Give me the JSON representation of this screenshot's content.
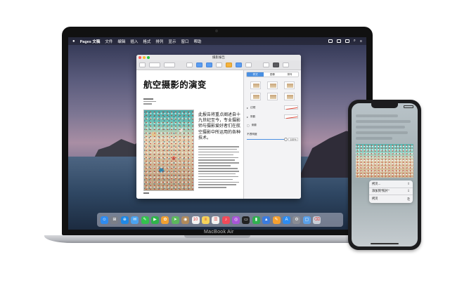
{
  "menubar": {
    "app_name": "Pages 文稿",
    "items": [
      "文件",
      "编辑",
      "插入",
      "格式",
      "排列",
      "显示",
      "窗口",
      "帮助"
    ]
  },
  "window": {
    "title": "摄影报告",
    "lights": [
      "#ff5f57",
      "#febc2e",
      "#28c840"
    ]
  },
  "document": {
    "title": "航空摄影的演变",
    "lead": "此报告将重点阐述自十九世纪至今，专业摄影师与摄影爱好者们在航空摄影中所运用的各种技术。"
  },
  "sidebar": {
    "tabs": [
      "样式",
      "图像",
      "排列"
    ],
    "active_tab": 0,
    "rows": [
      "边框",
      "阴影",
      "倒影"
    ],
    "opacity_label": "不透明度",
    "opacity_value": "100%",
    "opacity_level": 1.0
  },
  "dock": {
    "icons": [
      {
        "name": "finder-icon",
        "color": "#2f8cf0",
        "glyph": "☺"
      },
      {
        "name": "launchpad-icon",
        "color": "#7b7f88",
        "glyph": "⊞"
      },
      {
        "name": "safari-icon",
        "color": "#1e88e5",
        "glyph": "⊕"
      },
      {
        "name": "mail-icon",
        "color": "#4aa3f0",
        "glyph": "✉"
      },
      {
        "name": "messages-icon",
        "color": "#33c24d",
        "glyph": "✎"
      },
      {
        "name": "facetime-icon",
        "color": "#2fb34a",
        "glyph": "▶"
      },
      {
        "name": "photos-icon",
        "color": "#f0a030",
        "glyph": "✿"
      },
      {
        "name": "maps-icon",
        "color": "#5cb85c",
        "glyph": "➤"
      },
      {
        "name": "contacts-icon",
        "color": "#b08a5a",
        "glyph": "◉"
      },
      {
        "name": "calendar-icon",
        "color": "#f2f2f2",
        "glyph": "10"
      },
      {
        "name": "notes-icon",
        "color": "#f5d35a",
        "glyph": "≡"
      },
      {
        "name": "reminders-icon",
        "color": "#f2f2f2",
        "glyph": "☰"
      },
      {
        "name": "music-icon",
        "color": "#f04a5a",
        "glyph": "♪"
      },
      {
        "name": "podcasts-icon",
        "color": "#a855d8",
        "glyph": "◎"
      },
      {
        "name": "tv-icon",
        "color": "#222222",
        "glyph": "▭"
      },
      {
        "name": "numbers-icon",
        "color": "#30b050",
        "glyph": "▮"
      },
      {
        "name": "keynote-icon",
        "color": "#3a7be0",
        "glyph": "▲"
      },
      {
        "name": "pages-icon",
        "color": "#f5a030",
        "glyph": "✎"
      },
      {
        "name": "app-store-icon",
        "color": "#2d8cf0",
        "glyph": "A"
      },
      {
        "name": "system-preferences-icon",
        "color": "#8a8d94",
        "glyph": "⚙"
      },
      {
        "name": "downloads-folder-icon",
        "color": "#5aa0e8",
        "glyph": "▢"
      },
      {
        "name": "trash-icon",
        "color": "#c9ced6",
        "glyph": "⌫"
      }
    ]
  },
  "laptop_label": "MacBook Air",
  "phone": {
    "menu_items": [
      {
        "label": "拷贝...",
        "icon": "⇪"
      },
      {
        "label": "添加到\"照片\"",
        "icon": "⇩"
      },
      {
        "label": "拷贝",
        "icon": "⎘"
      }
    ]
  }
}
